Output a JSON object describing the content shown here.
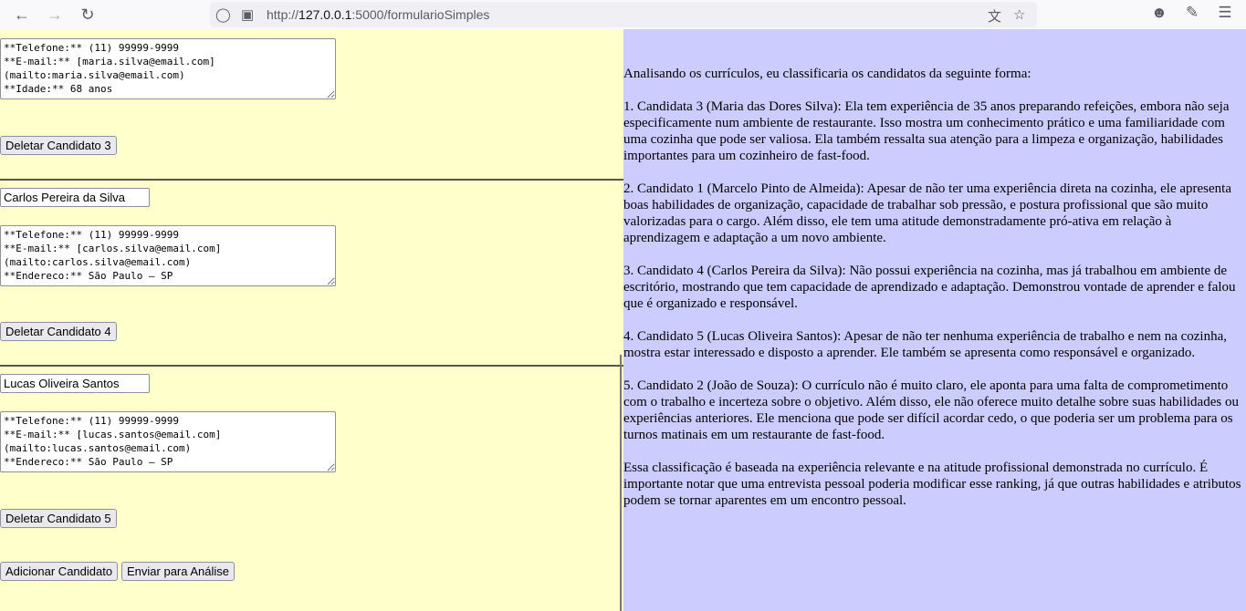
{
  "browser": {
    "url_prefix": "http://",
    "url_host": "127.0.0.1",
    "url_rest": ":5000/formularioSimples"
  },
  "candidates": [
    {
      "resume": "**Telefone:** (11) 99999-9999\n**E-mail:** [maria.silva@email.com]\n(mailto:maria.silva@email.com)\n**Idade:** 68 anos",
      "delete_label": "Deletar Candidato 3"
    },
    {
      "name": "Carlos Pereira da Silva",
      "resume": "**Telefone:** (11) 99999-9999\n**E-mail:** [carlos.silva@email.com]\n(mailto:carlos.silva@email.com)\n**Endereco:** São Paulo – SP",
      "delete_label": "Deletar Candidato 4"
    },
    {
      "name": "Lucas Oliveira Santos",
      "resume": "**Telefone:** (11) 99999-9999\n**E-mail:** [lucas.santos@email.com]\n(mailto:lucas.santos@email.com)\n**Endereco:** São Paulo – SP",
      "delete_label": "Deletar Candidato 5"
    }
  ],
  "actions": {
    "add_label": "Adicionar Candidato",
    "submit_label": "Enviar para Análise"
  },
  "analysis": {
    "paragraphs": [
      "Analisando os currículos, eu classificaria os candidatos da seguinte forma:",
      "1. Candidata 3 (Maria das Dores Silva): Ela tem experiência de 35 anos preparando refeições, embora não seja especificamente num ambiente de restaurante. Isso mostra um conhecimento prático e uma familiaridade com uma cozinha que pode ser valiosa. Ela também ressalta sua atenção para a limpeza e organização, habilidades importantes para um cozinheiro de fast-food.",
      "2. Candidato 1 (Marcelo Pinto de Almeida): Apesar de não ter uma experiência direta na cozinha, ele apresenta boas habilidades de organização, capacidade de trabalhar sob pressão, e postura profissional que são muito valorizadas para o cargo. Além disso, ele tem uma atitude demonstradamente pró-ativa em relação à aprendizagem e adaptação a um novo ambiente.",
      "3. Candidato 4 (Carlos Pereira da Silva): Não possui experiência na cozinha, mas já trabalhou em ambiente de escritório, mostrando que tem capacidade de aprendizado e adaptação. Demonstrou vontade de aprender e falou que é organizado e responsável.",
      "4. Candidato 5 (Lucas Oliveira Santos): Apesar de não ter nenhuma experiência de trabalho e nem na cozinha, mostra estar interessado e disposto a aprender. Ele também se apresenta como responsável e organizado.",
      "5. Candidato 2 (João de Souza): O currículo não é muito claro, ele aponta para uma falta de comprometimento com o trabalho e incerteza sobre o objetivo. Além disso, ele não oferece muito detalhe sobre suas habilidades ou experiências anteriores. Ele menciona que pode ser difícil acordar cedo, o que poderia ser um problema para os turnos matinais em um restaurante de fast-food.",
      "Essa classificação é baseada na experiência relevante e na atitude profissional demonstrada no currículo. É importante notar que uma entrevista pessoal poderia modificar esse ranking, já que outras habilidades e atributos podem se tornar aparentes em um encontro pessoal."
    ]
  }
}
